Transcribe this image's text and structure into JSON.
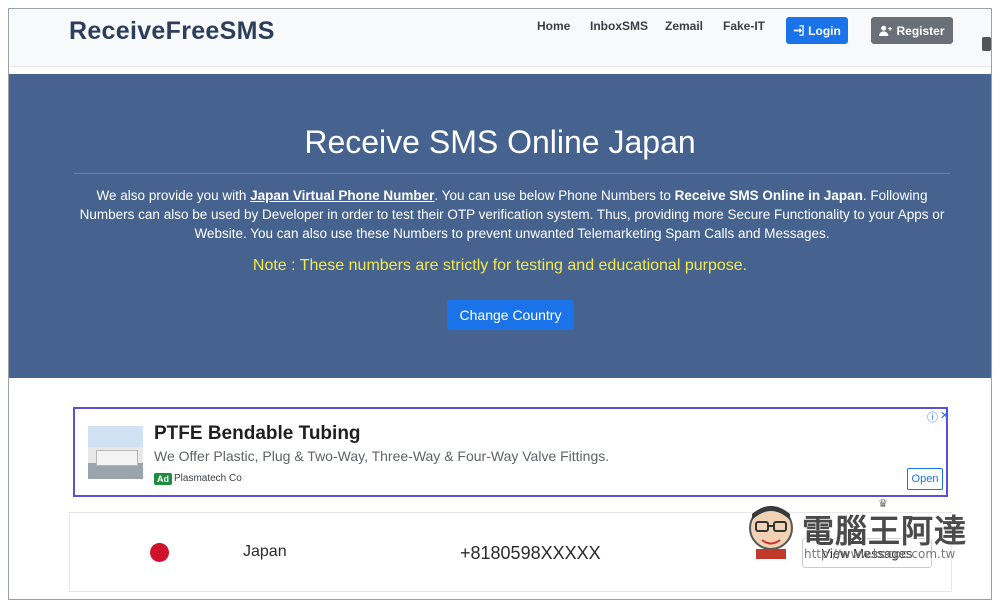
{
  "navbar": {
    "brand": "ReceiveFreeSMS",
    "links": [
      "Home",
      "InboxSMS",
      "Zemail",
      "Fake-IT"
    ],
    "login_label": "Login",
    "register_label": "Register"
  },
  "hero": {
    "title": "Receive SMS Online Japan",
    "text_1": "We also provide you with ",
    "text_link": "Japan Virtual Phone Number",
    "text_2": ". You can use below Phone Numbers to ",
    "text_bold": "Receive SMS Online in Japan",
    "text_3": ". Following Numbers can also be used by Developer in order to test their OTP verification system. Thus, providing more Secure Functionality to your Apps or Website. You can also use these Numbers to prevent unwanted Telemarketing Spam Calls and Messages.",
    "note": "Note : These numbers are strictly for testing and educational purpose.",
    "change_country_label": "Change Country"
  },
  "ad": {
    "title": "PTFE Bendable Tubing",
    "description": "We Offer Plastic, Plug & Two-Way, Three-Way & Four-Way Valve Fittings.",
    "badge": "Ad",
    "sponsor": "Plasmatech Co",
    "open_label": "Open",
    "info_icon": "ⓘ",
    "close_icon": "✕"
  },
  "numbers": [
    {
      "country": "Japan",
      "number": "+8180598XXXXX",
      "action_label": "View Messages"
    }
  ],
  "watermark": {
    "text": "電腦王阿達",
    "url": "http://www.kocpc.com.tw"
  },
  "colors": {
    "hero_bg": "#46638f",
    "primary": "#1a73e8",
    "note": "#f4e84a",
    "flag_red": "#d0112b"
  }
}
